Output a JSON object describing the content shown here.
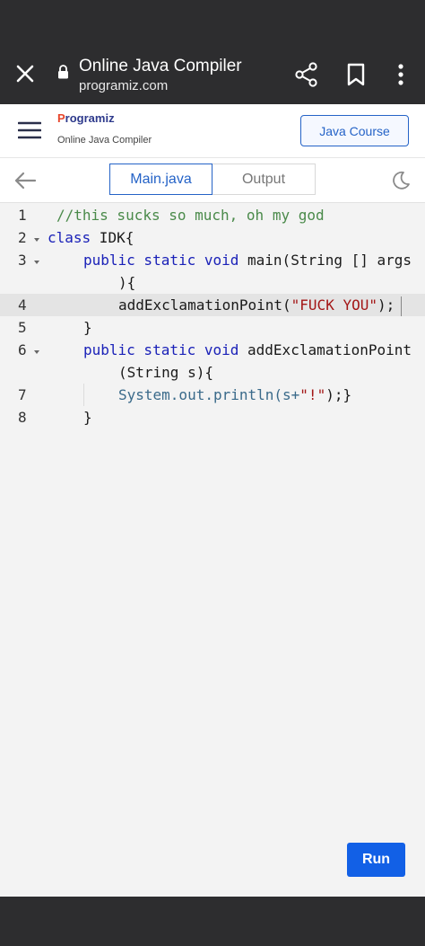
{
  "browser": {
    "title": "Online Java Compiler",
    "url": "programiz.com"
  },
  "header": {
    "logo_text": "rogramiz",
    "logo_initial": "P",
    "subtitle": "Online Java Compiler",
    "course_button": "Java Course"
  },
  "tabs": {
    "main": "Main.java",
    "output": "Output"
  },
  "editor": {
    "line_numbers": [
      "1",
      "2",
      "3",
      "4",
      "5",
      "6",
      "7",
      "8"
    ],
    "active_line": 4,
    "lines": {
      "l1": "//this sucks so much, oh my god",
      "l2_kw": "class",
      "l2_rest": " IDK{",
      "l3_kw": "public static void",
      "l3_rest": " main(String [] args",
      "l3_wrap": "){",
      "l4_pre": "addExclamationPoint(",
      "l4_str": "\"FUCK YOU\"",
      "l4_post": ");",
      "l5": "}",
      "l6_kw": "public static void",
      "l6_rest": " addExclamationPoint",
      "l6_wrap": "(String s){",
      "l7_pre": "System.out.println(s+",
      "l7_str": "\"!\"",
      "l7_post": ");}",
      "l8": "}"
    }
  },
  "run_button": "Run",
  "colors": {
    "accent": "#2563c7",
    "run": "#1260e6",
    "chrome": "#2d2d2f",
    "keyword": "#1a21b8",
    "comment": "#4a8a4a",
    "string": "#a31515"
  },
  "icons": {
    "close": "close-icon",
    "lock": "lock-icon",
    "share": "share-icon",
    "bookmark": "bookmark-icon",
    "more": "more-vert-icon",
    "menu": "hamburger-icon",
    "back": "back-arrow-icon",
    "theme": "moon-icon"
  }
}
